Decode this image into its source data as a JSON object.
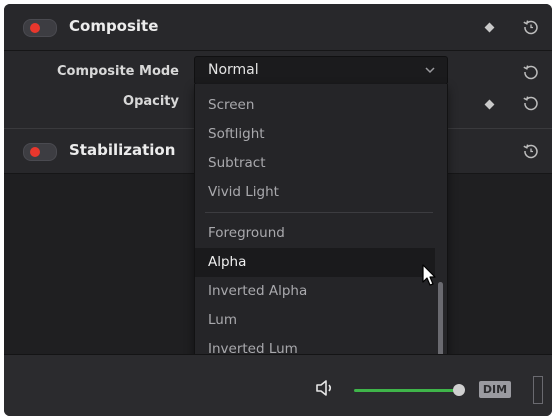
{
  "composite": {
    "title": "Composite",
    "mode_label": "Composite Mode",
    "mode_value": "Normal",
    "opacity_label": "Opacity",
    "enabled": true
  },
  "stabilization": {
    "title": "Stabilization",
    "enabled": true
  },
  "dropdown": {
    "group1": [
      "Screen",
      "Softlight",
      "Subtract",
      "Vivid Light"
    ],
    "group2": [
      "Foreground",
      "Alpha",
      "Inverted Alpha",
      "Lum",
      "Inverted Lum"
    ],
    "highlighted": "Alpha"
  },
  "bottom": {
    "dim_label": "DIM",
    "volume_level": 0.95
  },
  "colors": {
    "toggle_on": "#e8372d",
    "volume": "#3fb54a",
    "panel_bg": "#1f1f21"
  },
  "icons": {
    "keyframe": "diamond-icon",
    "reset": "reset-icon",
    "speaker": "speaker-icon",
    "chevron": "chevron-down-icon",
    "cursor": "mouse-pointer-icon"
  }
}
